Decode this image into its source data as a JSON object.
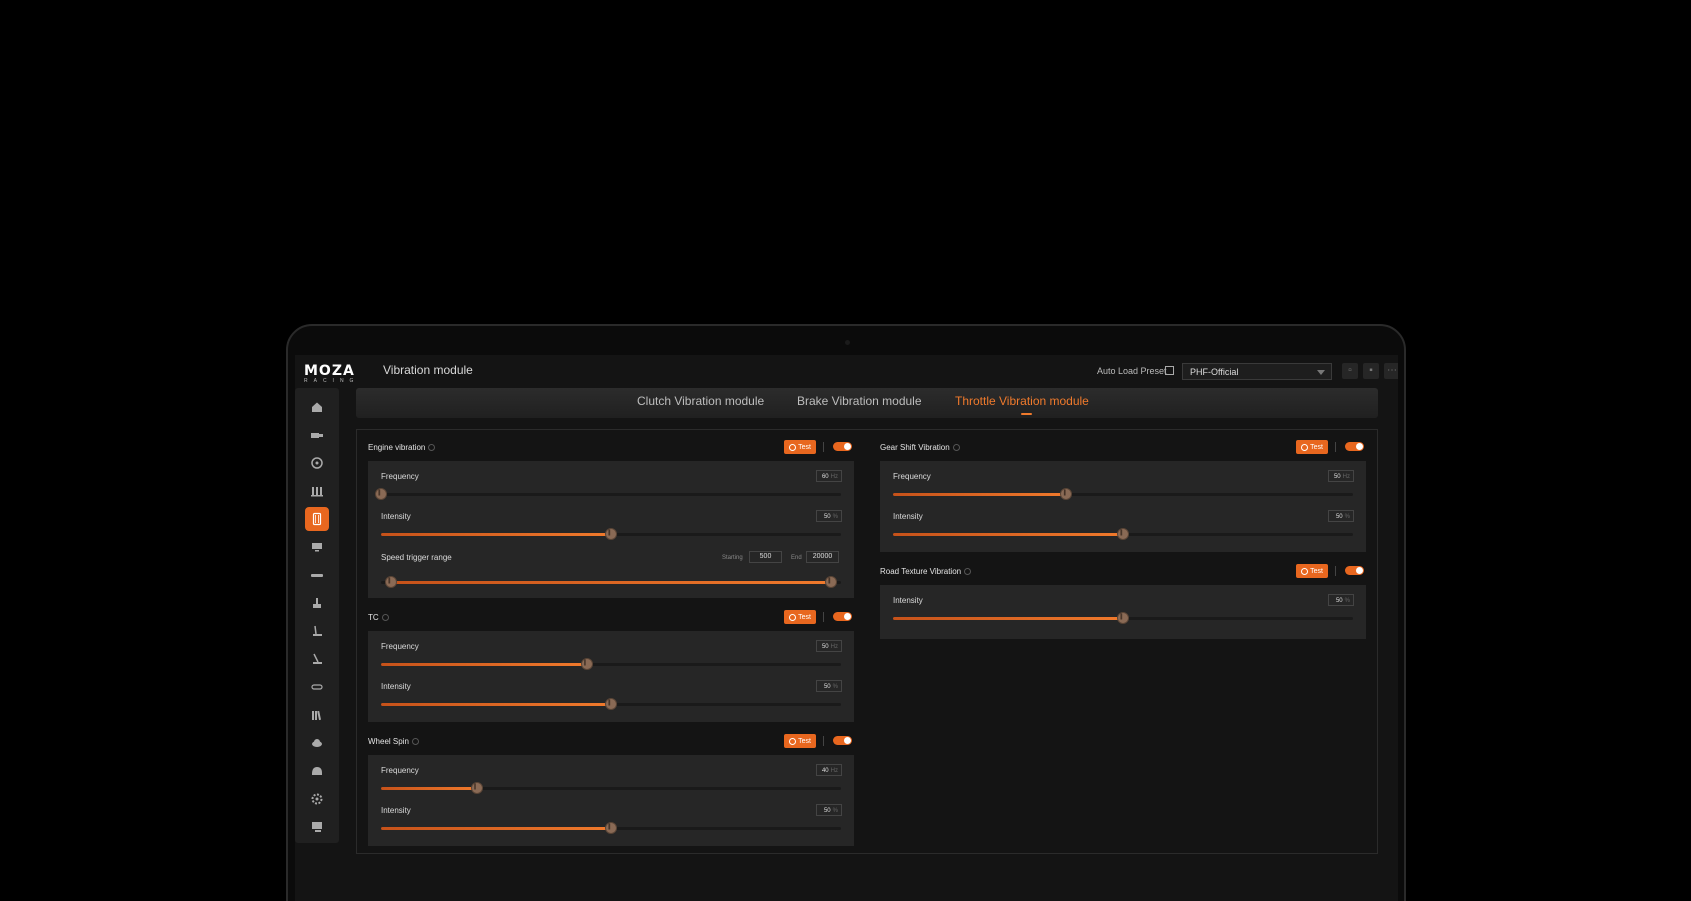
{
  "app": {
    "logo_main": "MOZA",
    "logo_sub": "RACING",
    "title": "Vibration module",
    "auto_load_label": "Auto Load Preset",
    "preset_value": "PHF-Official"
  },
  "sidebar": {
    "items": [
      {
        "icon": "home-icon"
      },
      {
        "icon": "truck-icon"
      },
      {
        "icon": "steering-wheel-icon"
      },
      {
        "icon": "pedals-icon"
      },
      {
        "icon": "vibration-module-icon",
        "active": true
      },
      {
        "icon": "display-icon"
      },
      {
        "icon": "handbrake-icon"
      },
      {
        "icon": "shifter-icon"
      },
      {
        "icon": "gear-lever-icon"
      },
      {
        "icon": "sequential-shifter-icon"
      },
      {
        "icon": "button-box-icon"
      },
      {
        "icon": "library-icon"
      },
      {
        "icon": "cloud-icon"
      },
      {
        "icon": "helmet-icon"
      },
      {
        "icon": "settings-icon"
      },
      {
        "icon": "support-icon"
      }
    ]
  },
  "tabs": [
    {
      "label": "Clutch Vibration module",
      "active": false
    },
    {
      "label": "Brake Vibration module",
      "active": false
    },
    {
      "label": "Throttle Vibration module",
      "active": true
    }
  ],
  "test_label": "Test",
  "sections": {
    "engine": {
      "title": "Engine vibration",
      "enabled": true,
      "frequency": {
        "label": "Frequency",
        "value": "60",
        "unit": "Hz",
        "fraction": 0.0
      },
      "intensity": {
        "label": "Intensity",
        "value": "50",
        "unit": "%",
        "fraction": 0.5
      },
      "speed_range": {
        "label": "Speed trigger range",
        "start_label": "Starting",
        "start_value": "500",
        "end_label": "End",
        "end_value": "20000"
      }
    },
    "tc": {
      "title": "TC",
      "enabled": true,
      "frequency": {
        "label": "Frequency",
        "value": "50",
        "unit": "Hz",
        "fraction": 0.447
      },
      "intensity": {
        "label": "Intensity",
        "value": "50",
        "unit": "%",
        "fraction": 0.5
      }
    },
    "wheel_spin": {
      "title": "Wheel Spin",
      "enabled": true,
      "frequency": {
        "label": "Frequency",
        "value": "40",
        "unit": "Hz",
        "fraction": 0.208
      },
      "intensity": {
        "label": "Intensity",
        "value": "50",
        "unit": "%",
        "fraction": 0.5
      }
    },
    "gear_shift": {
      "title": "Gear Shift Vibration",
      "enabled": true,
      "frequency": {
        "label": "Frequency",
        "value": "50",
        "unit": "Hz",
        "fraction": 0.377
      },
      "intensity": {
        "label": "Intensity",
        "value": "50",
        "unit": "%",
        "fraction": 0.5
      }
    },
    "road_texture": {
      "title": "Road Texture Vibration",
      "enabled": true,
      "intensity": {
        "label": "Intensity",
        "value": "50",
        "unit": "%",
        "fraction": 0.5
      }
    }
  }
}
